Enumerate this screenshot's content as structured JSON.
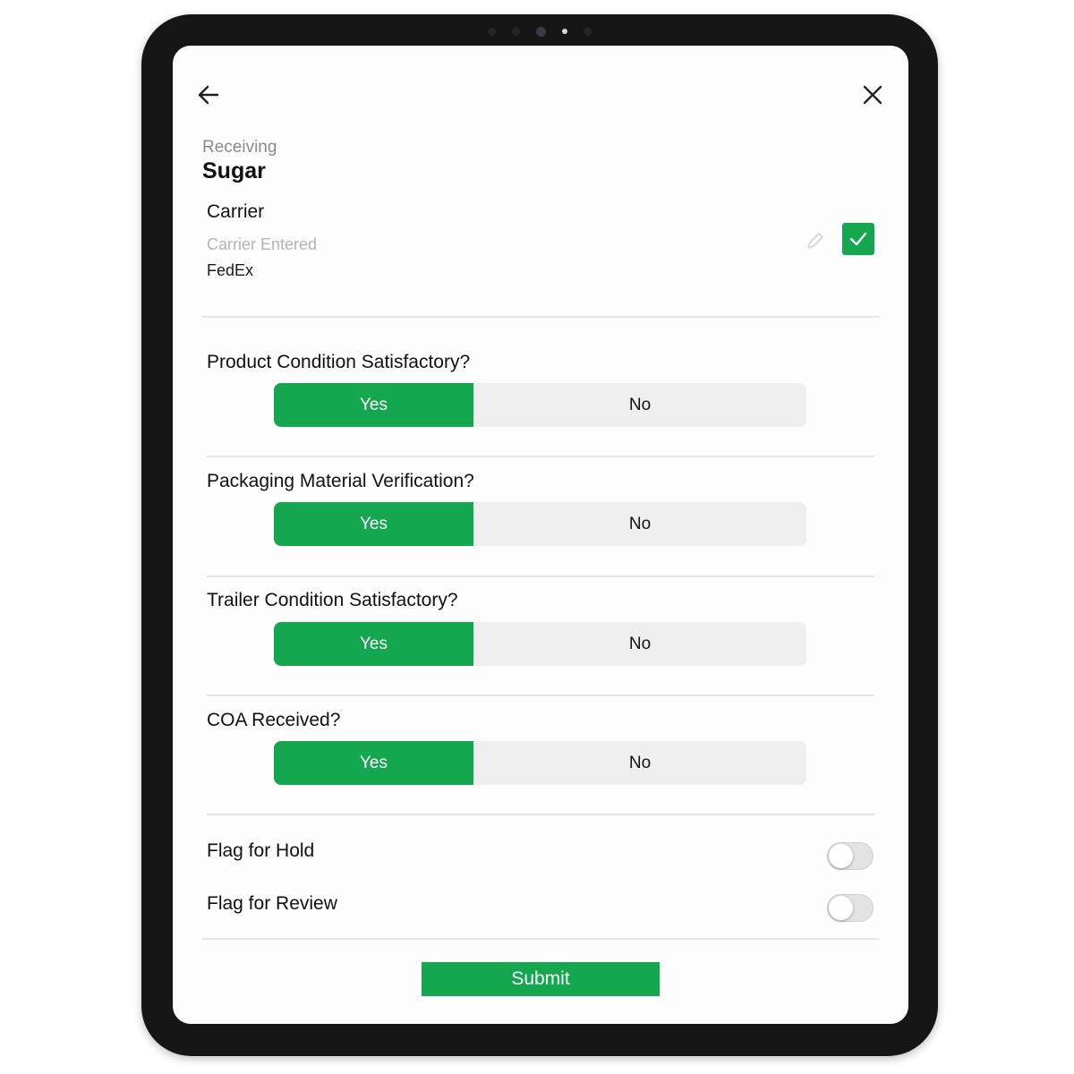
{
  "nav": {
    "back_icon": "arrow-left-icon",
    "close_icon": "close-x-icon"
  },
  "header": {
    "breadcrumb": "Receiving",
    "title": "Sugar"
  },
  "carrier": {
    "section_label": "Carrier",
    "field_label": "Carrier Entered",
    "value": "FedEx",
    "edit_icon": "pencil-icon",
    "confirmed": true
  },
  "questions": [
    {
      "label": "Product Condition Satisfactory?",
      "yes_label": "Yes",
      "no_label": "No",
      "selected": "Yes"
    },
    {
      "label": "Packaging Material Verification?",
      "yes_label": "Yes",
      "no_label": "No",
      "selected": "Yes"
    },
    {
      "label": "Trailer Condition Satisfactory?",
      "yes_label": "Yes",
      "no_label": "No",
      "selected": "Yes"
    },
    {
      "label": "COA Received?",
      "yes_label": "Yes",
      "no_label": "No",
      "selected": "Yes"
    }
  ],
  "flags": [
    {
      "label": "Flag for Hold",
      "on": false
    },
    {
      "label": "Flag for Review",
      "on": false
    }
  ],
  "submit_label": "Submit",
  "colors": {
    "accent": "#14a750",
    "segment_bg": "#efefef"
  }
}
